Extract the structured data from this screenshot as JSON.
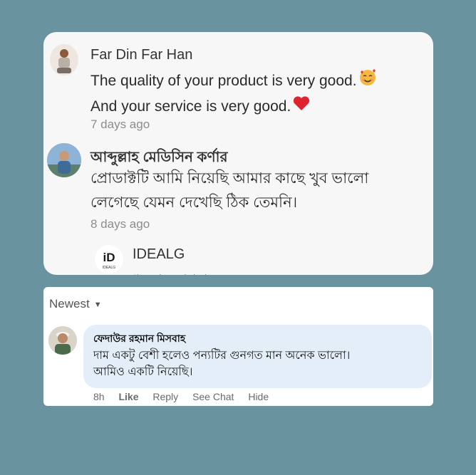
{
  "top_card": {
    "clipped_header_text": "· · ·",
    "comments": [
      {
        "author": "Far Din Far Han",
        "lines": [
          "The quality of your product is very good.",
          "And your service is very good."
        ],
        "emojis": [
          "smiling-face-with-hearts-emoji",
          "red-heart-emoji"
        ],
        "time": "7 days ago"
      },
      {
        "author": "আব্দুল্লাহ মেডিসিন কর্ণার",
        "lines": [
          "প্রোডাক্টটি আমি নিয়েছি আমার কাছে খুব ভালো",
          "লেগেছে যেমন দেখেছি ঠিক তেমনি।"
        ],
        "time": "8 days ago"
      }
    ],
    "reply": {
      "author": "IDEALG",
      "logo_text": "iD",
      "logo_subtext": "IDEALG",
      "cut_text": "ধন্যবাদ আপনার"
    }
  },
  "bottom_card": {
    "sort_label": "Newest",
    "comment": {
      "author": "ফেদাউর রহমান মিসবাহ",
      "lines": [
        "দাম একটু বেশী হলেও পন্যটির গুনগত মান অনেক ভালো।",
        "আমিও একটি নিয়েছি।"
      ],
      "time": "8h",
      "actions": {
        "like": "Like",
        "reply": "Reply",
        "see_chat": "See Chat",
        "hide": "Hide"
      }
    }
  }
}
